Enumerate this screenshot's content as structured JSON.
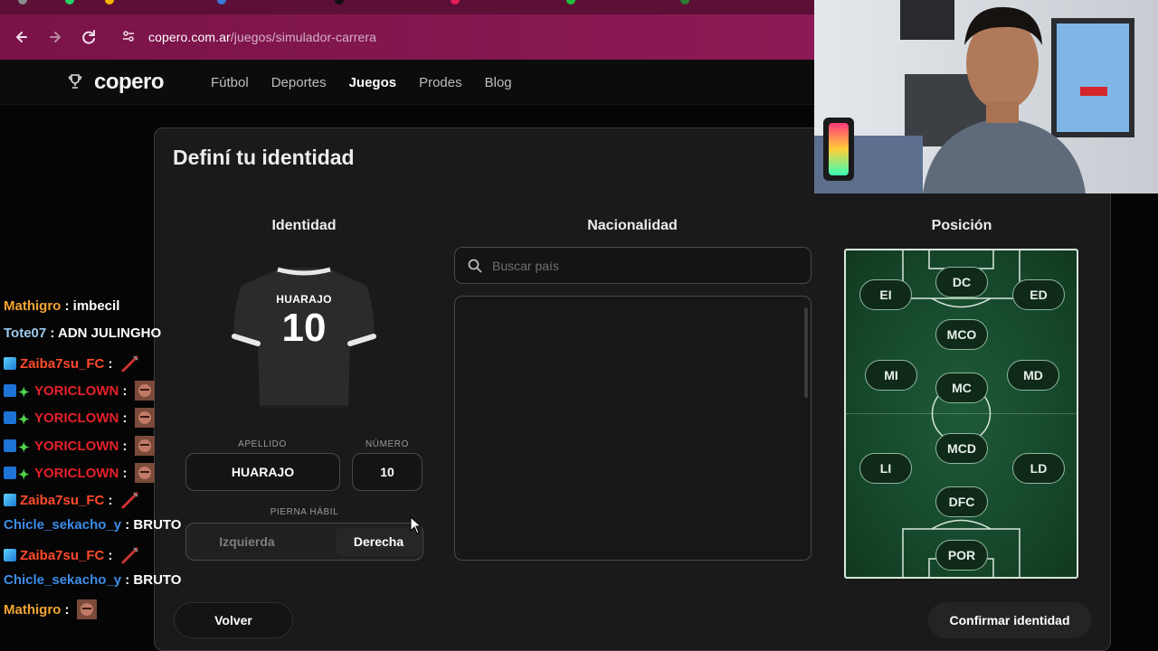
{
  "browser": {
    "url_host": "copero.com.ar",
    "url_path": "/juegos/simulador-carrera"
  },
  "site": {
    "logo_text": "copero",
    "nav": [
      {
        "label": "Fútbol",
        "active": false
      },
      {
        "label": "Deportes",
        "active": false
      },
      {
        "label": "Juegos",
        "active": true
      },
      {
        "label": "Prodes",
        "active": false
      },
      {
        "label": "Blog",
        "active": false
      }
    ]
  },
  "card": {
    "title": "Definí tu identidad",
    "identity": {
      "heading": "Identidad",
      "jersey_name": "HUARAJO",
      "jersey_number": "10",
      "surname_label": "APELLIDO",
      "surname_value": "HUARAJO",
      "number_label": "NÚMERO",
      "number_value": "10",
      "foot_label": "PIERNA HÁBIL",
      "foot_left": "Izquierda",
      "foot_right": "Derecha",
      "foot_selected": "Derecha"
    },
    "nationality": {
      "heading": "Nacionalidad",
      "search_placeholder": "Buscar país"
    },
    "position": {
      "heading": "Posición",
      "positions": [
        "DC",
        "EI",
        "ED",
        "MCO",
        "MI",
        "MC",
        "MD",
        "MCD",
        "LI",
        "LD",
        "DFC",
        "POR"
      ]
    },
    "back_label": "Volver",
    "confirm_label": "Confirmar identidad"
  },
  "chat": [
    {
      "user": "Mathigro",
      "user_color": "#f2a531",
      "message": "imbecil",
      "badge": "",
      "emote": false
    },
    {
      "user": "Tote07",
      "user_color": "#9ecbf0",
      "message": "ADN JULINGHO",
      "badge": "",
      "emote": false
    },
    {
      "user": "Zaiba7su_FC",
      "user_color": "#ff4a2c",
      "message": "",
      "badge": "cube",
      "emote": true
    },
    {
      "user": "YORICLOWN",
      "user_color": "#e5202a",
      "message": "",
      "badge": "double",
      "emote": true
    },
    {
      "user": "YORICLOWN",
      "user_color": "#e5202a",
      "message": "",
      "badge": "double",
      "emote": true
    },
    {
      "user": "YORICLOWN",
      "user_color": "#e5202a",
      "message": "",
      "badge": "double",
      "emote": true
    },
    {
      "user": "YORICLOWN",
      "user_color": "#e5202a",
      "message": "",
      "badge": "double",
      "emote": true
    },
    {
      "user": "Zaiba7su_FC",
      "user_color": "#ff4a2c",
      "message": "",
      "badge": "cube",
      "emote": true
    },
    {
      "user": "Chicle_sekacho_y",
      "user_color": "#3d8ce8",
      "message": "BRUTO",
      "badge": "",
      "emote": false
    },
    {
      "user": "Zaiba7su_FC",
      "user_color": "#ff4a2c",
      "message": "",
      "badge": "cube",
      "emote": true
    },
    {
      "user": "Chicle_sekacho_y",
      "user_color": "#3d8ce8",
      "message": "BRUTO",
      "badge": "",
      "emote": false
    },
    {
      "user": "Mathigro",
      "user_color": "#f2a531",
      "message": "",
      "badge": "",
      "emote": true
    }
  ],
  "colors": {
    "browser_accent": "#7a1349",
    "pitch_green": "#1e5a38",
    "card_bg": "#1a1a1a"
  }
}
